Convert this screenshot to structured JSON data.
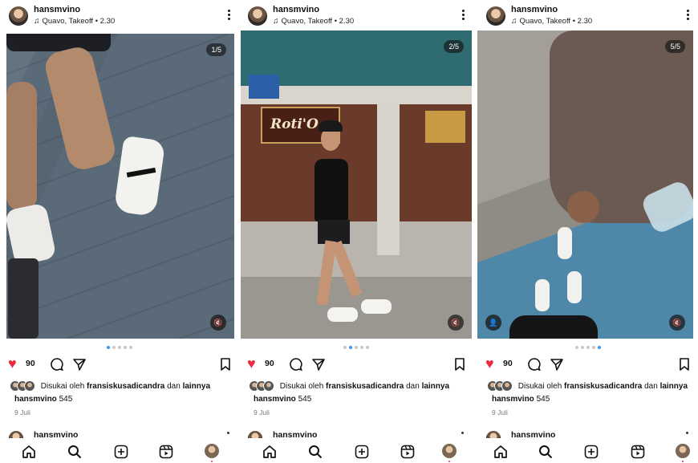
{
  "posts": [
    {
      "username": "hansmvino",
      "audio": "Quavo, Takeoff • 2.30",
      "counter": "1/5",
      "likes": "90",
      "liked_by_prefix": "Disukai oleh",
      "liked_by_user": "fransiskusadicandra",
      "liked_by_suffix": "dan",
      "liked_by_others": "lainnya",
      "caption_user": "hansmvino",
      "caption_text": "545",
      "date": "9 Juli",
      "next_username": "hansmvino",
      "active_dot": 0,
      "has_tag": false
    },
    {
      "username": "hansmvino",
      "audio": "Quavo, Takeoff • 2.30",
      "counter": "2/5",
      "likes": "90",
      "liked_by_prefix": "Disukai oleh",
      "liked_by_user": "fransiskusadicandra",
      "liked_by_suffix": "dan",
      "liked_by_others": "lainnya",
      "caption_user": "hansmvino",
      "caption_text": "545",
      "date": "9 Juli",
      "next_username": "hansmvino",
      "active_dot": 1,
      "has_tag": false
    },
    {
      "username": "hansmvino",
      "audio": "Quavo, Takeoff • 2.30",
      "counter": "5/5",
      "likes": "90",
      "liked_by_prefix": "Disukai oleh",
      "liked_by_user": "fransiskusadicandra",
      "liked_by_suffix": "dan",
      "liked_by_others": "lainnya",
      "caption_user": "hansmvino",
      "caption_text": "545",
      "date": "9 Juli",
      "next_username": "hansmvino",
      "active_dot": 4,
      "has_tag": true
    }
  ],
  "shop_sign": "Roti'O",
  "icons": {
    "audio": "music-note-icon",
    "more": "more-vertical-icon",
    "like": "heart-filled-icon",
    "comment": "comment-icon",
    "share": "send-icon",
    "save": "bookmark-icon",
    "mute": "speaker-muted-icon",
    "tag": "user-tag-icon",
    "nav": [
      "home-icon",
      "search-icon",
      "create-icon",
      "reels-icon",
      "profile-avatar"
    ]
  },
  "colors": {
    "like": "#ed2b3f",
    "pager_active": "#3897f0",
    "pager_inactive": "#c9c9c9"
  }
}
